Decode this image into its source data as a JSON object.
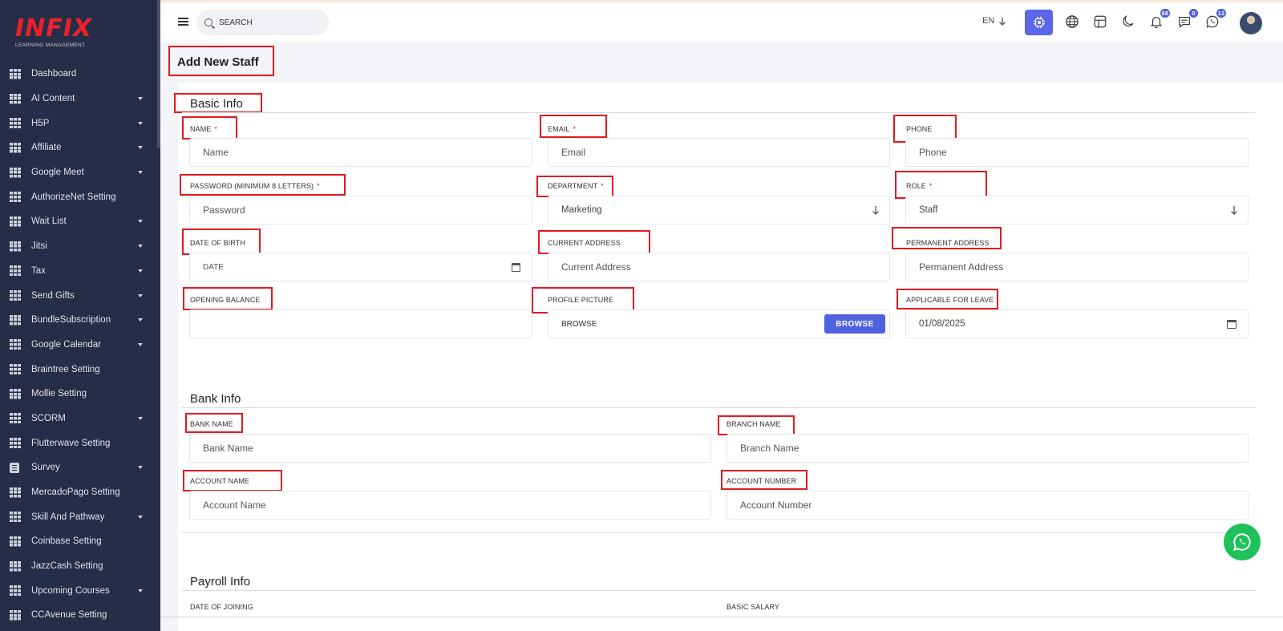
{
  "brand": {
    "name": "INFIX",
    "tagline": "LEARNING MANAGEMENT"
  },
  "sidebar": {
    "items": [
      {
        "label": "Dashboard",
        "caret": false,
        "icon": "grid-icon"
      },
      {
        "label": "AI Content",
        "caret": true,
        "icon": "grid-icon"
      },
      {
        "label": "H5P",
        "caret": true,
        "icon": "grid-icon"
      },
      {
        "label": "Affiliate",
        "caret": true,
        "icon": "grid-icon"
      },
      {
        "label": "Google Meet",
        "caret": true,
        "icon": "grid-icon"
      },
      {
        "label": "AuthorizeNet Setting",
        "caret": false,
        "icon": "grid-icon"
      },
      {
        "label": "Wait List",
        "caret": true,
        "icon": "grid-icon"
      },
      {
        "label": "Jitsi",
        "caret": true,
        "icon": "grid-icon"
      },
      {
        "label": "Tax",
        "caret": true,
        "icon": "grid-icon"
      },
      {
        "label": "Send Gifts",
        "caret": true,
        "icon": "grid-icon"
      },
      {
        "label": "BundleSubscription",
        "caret": true,
        "icon": "grid-icon"
      },
      {
        "label": "Google Calendar",
        "caret": true,
        "icon": "grid-icon"
      },
      {
        "label": "Braintree Setting",
        "caret": false,
        "icon": "grid-icon"
      },
      {
        "label": "Mollie Setting",
        "caret": false,
        "icon": "grid-icon"
      },
      {
        "label": "SCORM",
        "caret": true,
        "icon": "grid-icon"
      },
      {
        "label": "Flutterwave Setting",
        "caret": false,
        "icon": "grid-icon"
      },
      {
        "label": "Survey",
        "caret": true,
        "icon": "survey-icon"
      },
      {
        "label": "MercadoPago Setting",
        "caret": false,
        "icon": "grid-icon"
      },
      {
        "label": "Skill And Pathway",
        "caret": true,
        "icon": "grid-icon"
      },
      {
        "label": "Coinbase Setting",
        "caret": false,
        "icon": "grid-icon"
      },
      {
        "label": "JazzCash Setting",
        "caret": false,
        "icon": "grid-icon"
      },
      {
        "label": "Upcoming Courses",
        "caret": true,
        "icon": "grid-icon"
      },
      {
        "label": "CCAvenue Setting",
        "caret": false,
        "icon": "grid-icon"
      }
    ]
  },
  "topbar": {
    "search_placeholder": "SEARCH",
    "language": "EN",
    "icons": [
      "chip-icon",
      "globe-icon",
      "layout-icon",
      "moon-icon",
      "bell-icon",
      "chat-icon",
      "whatsapp-icon"
    ],
    "badges": {
      "notifications": "68",
      "messages": "0",
      "whatsapp": "13"
    }
  },
  "page": {
    "title": "Add New Staff"
  },
  "basic_info": {
    "title": "Basic Info",
    "name_label": "NAME",
    "name_placeholder": "Name",
    "email_label": "EMAIL",
    "email_placeholder": "Email",
    "phone_label": "PHONE",
    "phone_placeholder": "Phone",
    "password_label": "PASSWORD (MINIMUM 8 LETTERS)",
    "password_placeholder": "Password",
    "department_label": "DEPARTMENT",
    "department_value": "Marketing",
    "role_label": "ROLE",
    "role_value": "Staff",
    "dob_label": "DATE OF BIRTH",
    "dob_placeholder": "DATE",
    "current_address_label": "CURRENT ADDRESS",
    "current_address_placeholder": "Current Address",
    "permanent_address_label": "PERMANENT ADDRESS",
    "permanent_address_placeholder": "Permanent Address",
    "opening_balance_label": "OPENING BALANCE",
    "opening_balance_value": "",
    "profile_picture_label": "PROFILE PICTURE",
    "profile_picture_text": "BROWSE",
    "browse_button": "BROWSE",
    "leave_label": "APPLICABLE FOR LEAVE",
    "leave_value": "01/08/2025",
    "required_mark": "*"
  },
  "bank_info": {
    "title": "Bank Info",
    "bank_name_label": "BANK NAME",
    "bank_name_placeholder": "Bank Name",
    "branch_name_label": "BRANCH NAME",
    "branch_name_placeholder": "Branch Name",
    "account_name_label": "ACCOUNT NAME",
    "account_name_placeholder": "Account Name",
    "account_number_label": "ACCOUNT NUMBER",
    "account_number_placeholder": "Account Number"
  },
  "payroll_info": {
    "title": "Payroll Info",
    "date_of_joining_label": "DATE OF JOINING",
    "basic_salary_label": "BASIC SALARY"
  },
  "colors": {
    "sidebar": "#262d47",
    "accent": "#5a67e8",
    "highlight": "#e3191f",
    "brand": "#e8222b",
    "whatsapp": "#1fc15a"
  }
}
